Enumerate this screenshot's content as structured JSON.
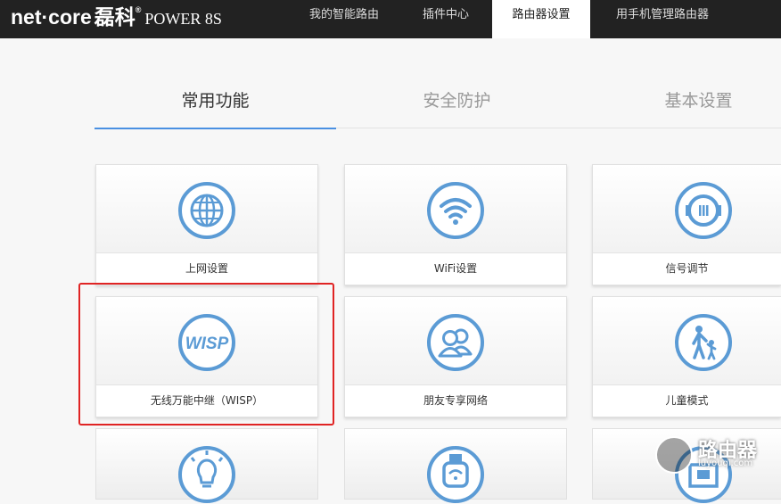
{
  "header": {
    "brand": "net·core",
    "brand_cn": "磊科",
    "brand_mark": "®",
    "model": "POWER 8S",
    "nav": [
      "我的智能路由",
      "插件中心",
      "路由器设置",
      "用手机管理路由器"
    ],
    "active_nav": "路由器设置"
  },
  "tabs": [
    "常用功能",
    "安全防护",
    "基本设置"
  ],
  "active_tab": "常用功能",
  "cards": [
    {
      "label": "上网设置",
      "icon": "globe-icon"
    },
    {
      "label": "WiFi设置",
      "icon": "wifi-icon"
    },
    {
      "label": "信号调节",
      "icon": "signal-tune-icon"
    },
    {
      "label": "无线万能中继（WISP）",
      "icon": "wisp-icon",
      "icon_text": "WISP"
    },
    {
      "label": "朋友专享网络",
      "icon": "friends-icon"
    },
    {
      "label": "儿童模式",
      "icon": "child-mode-icon"
    },
    {
      "label": "",
      "icon": "lightbulb-icon"
    },
    {
      "label": "",
      "icon": "wifi-watch-icon"
    },
    {
      "label": "",
      "icon": "network-port-icon"
    }
  ],
  "watermark": {
    "text": "路由器",
    "url": "luyouqi.com"
  },
  "colors": {
    "accent": "#4a90e2",
    "icon_blue": "#5b9bd5",
    "topbar": "#222222",
    "highlight": "#e02424"
  }
}
